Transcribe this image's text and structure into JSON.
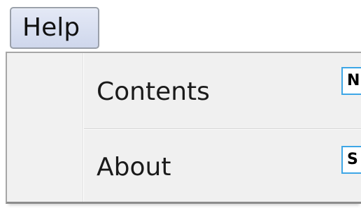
{
  "menubar": {
    "help_label": "Help"
  },
  "menu": {
    "items": [
      {
        "label": "Contents",
        "key_hint": "N"
      },
      {
        "label": "About",
        "key_hint": "S"
      }
    ]
  },
  "colors": {
    "menubar_highlight": "#d6ddef",
    "menu_background": "#f0f0f0",
    "key_hint_border": "#3da6e6"
  }
}
